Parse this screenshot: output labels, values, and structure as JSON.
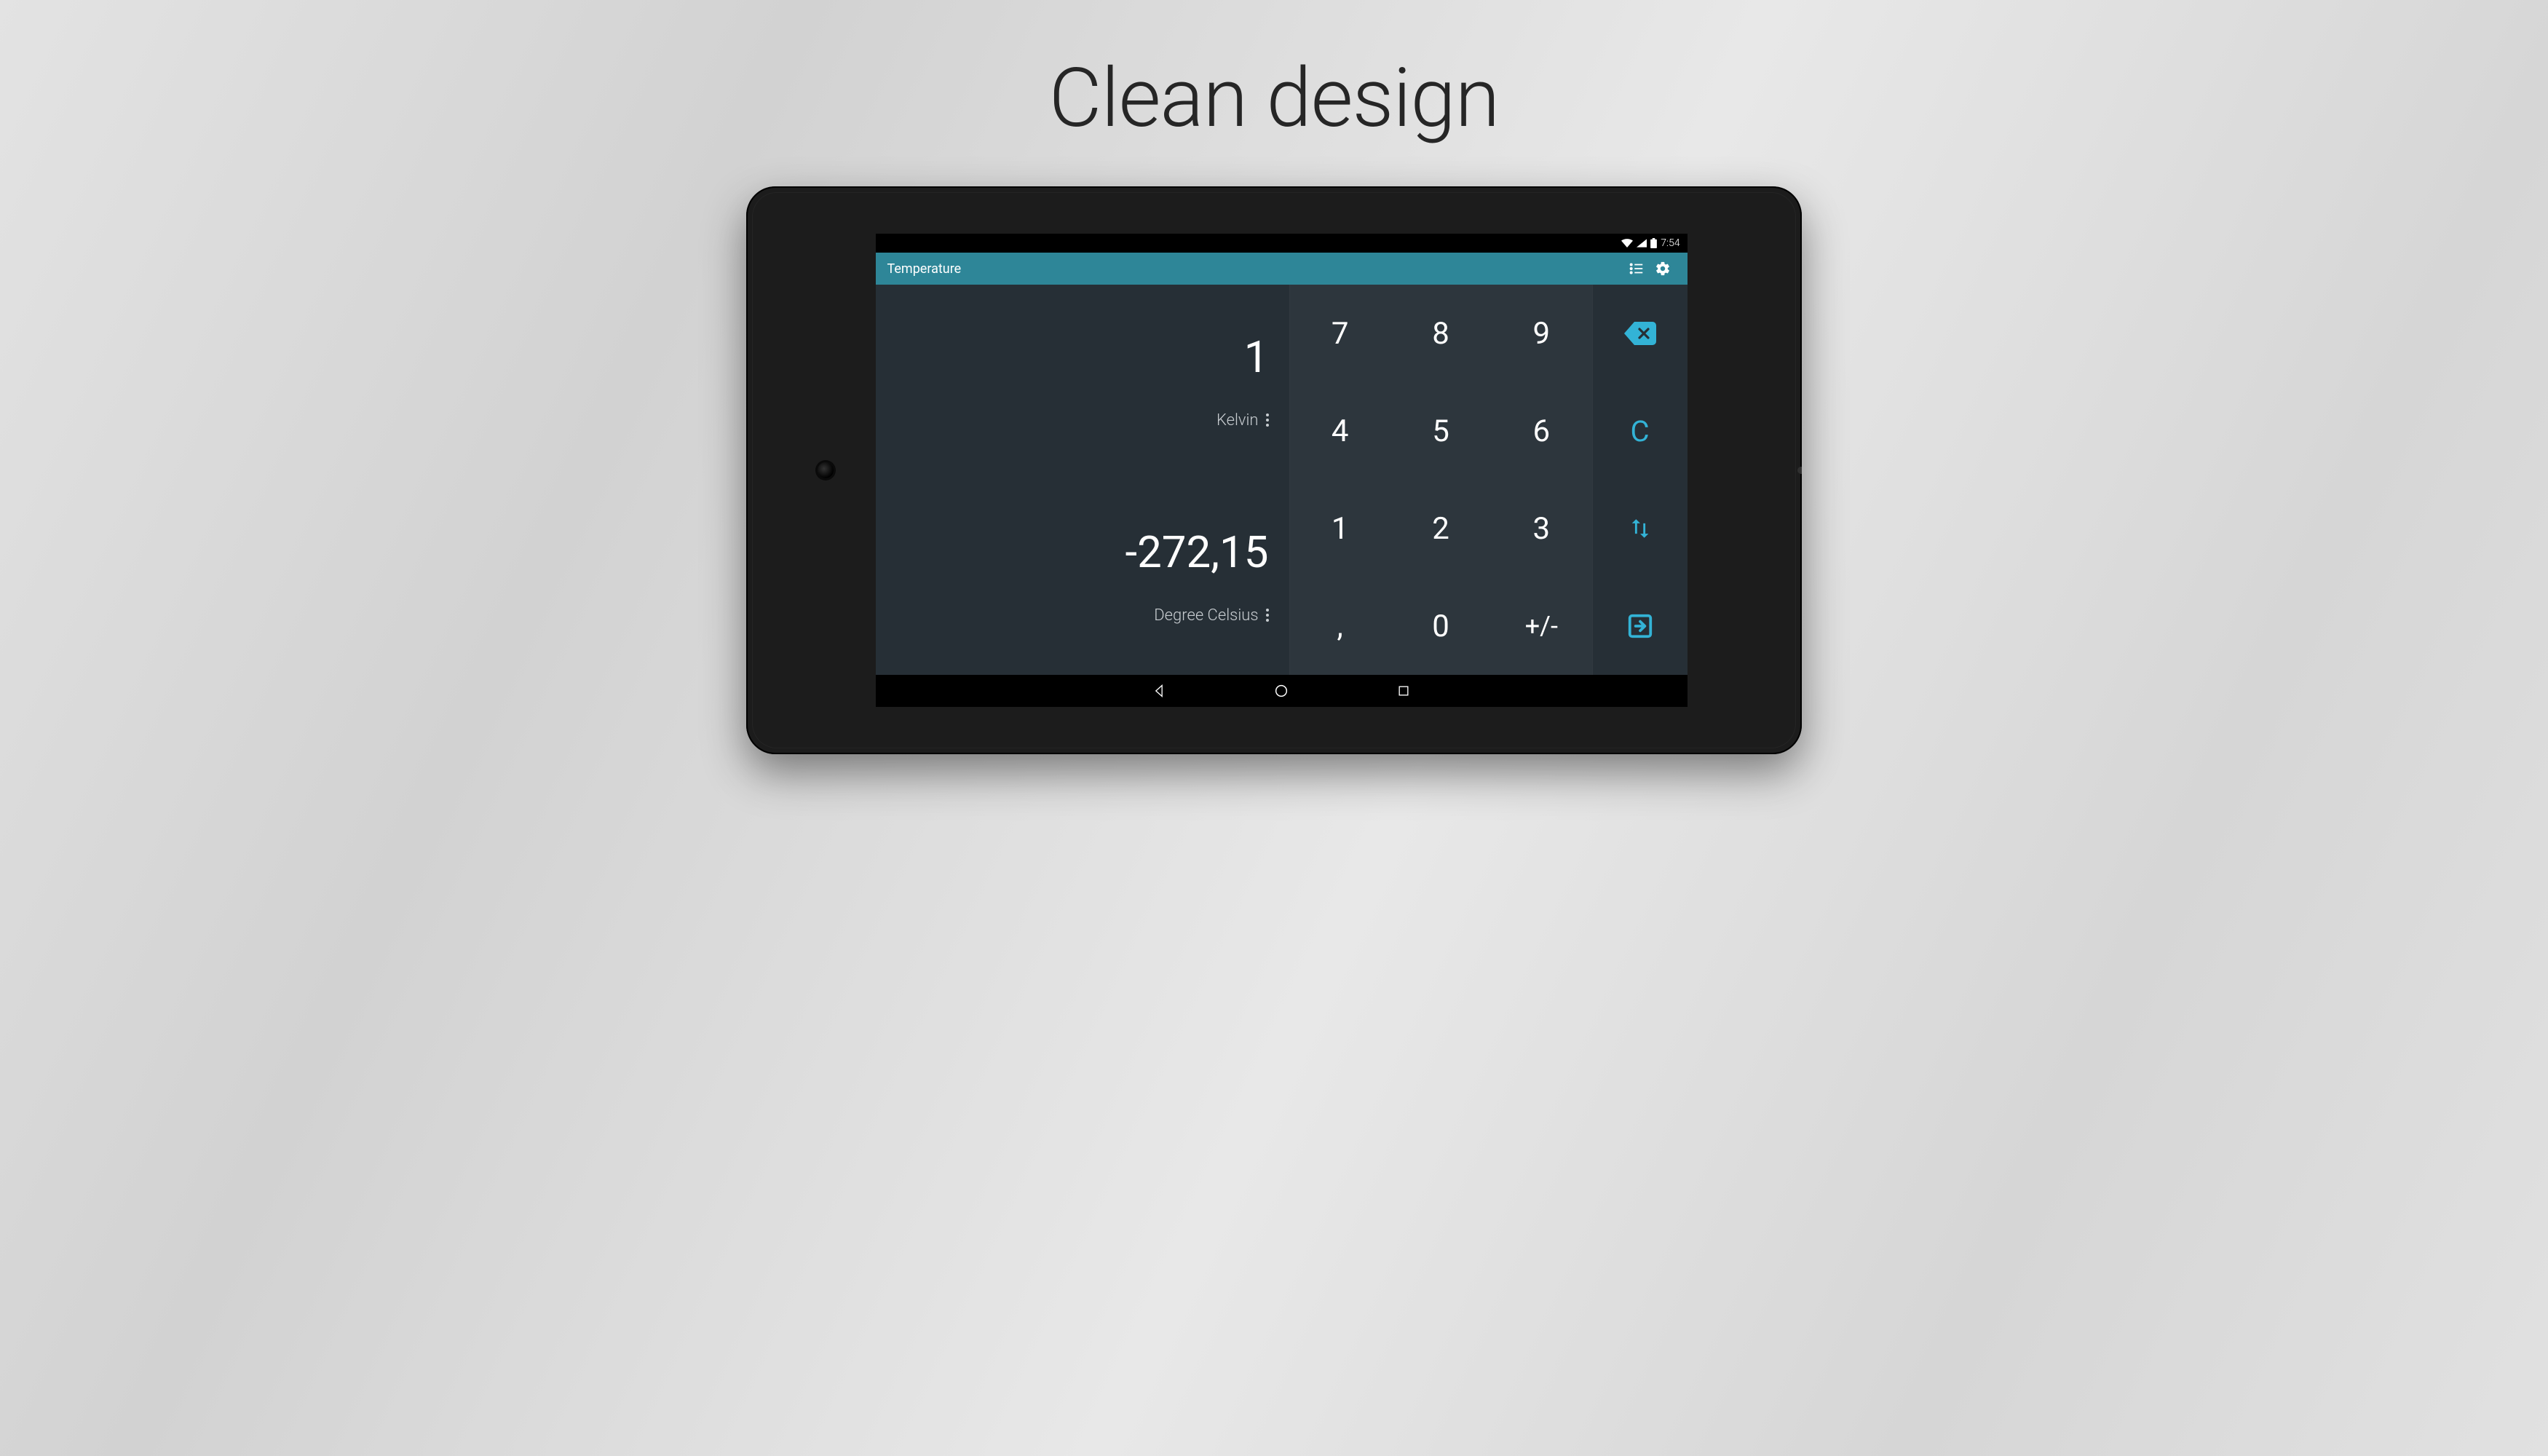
{
  "promo": {
    "headline": "Clean design"
  },
  "statusbar": {
    "time": "7:54"
  },
  "actionbar": {
    "title": "Temperature",
    "list_icon": "list-icon",
    "settings_icon": "settings-icon"
  },
  "converter": {
    "input_value": "1",
    "input_unit": "Kelvin",
    "output_value": "-272,15",
    "output_unit": "Degree Celsius"
  },
  "keypad": {
    "keys": [
      "7",
      "8",
      "9",
      "4",
      "5",
      "6",
      "1",
      "2",
      "3",
      ",",
      "0",
      "+/-"
    ]
  },
  "sidecol": {
    "backspace": "backspace-icon",
    "clear_label": "C",
    "swap": "swap-icon",
    "enter": "enter-icon"
  },
  "navbar": {
    "back": "back-icon",
    "home": "home-icon",
    "recent": "recent-icon"
  },
  "colors": {
    "accent": "#33b3d6",
    "actionbar": "#2e8698",
    "display_bg": "#262f36",
    "keypad_bg": "#2d363d"
  }
}
